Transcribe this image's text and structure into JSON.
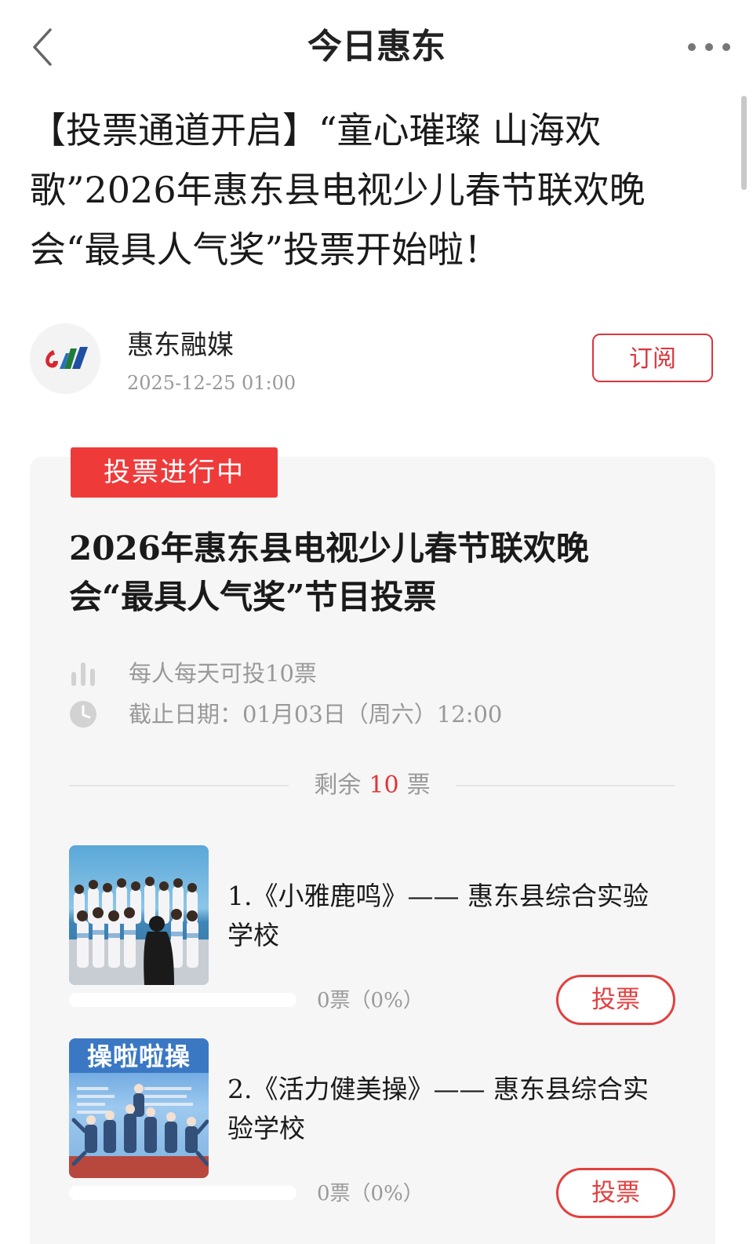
{
  "header": {
    "title": "今日惠东"
  },
  "article": {
    "title": "【投票通道开启】“童心璀璨 山海欢歌”2026年惠东县电视少儿春节联欢晚会“最具人气奖”投票开始啦！"
  },
  "author": {
    "name": "惠东融媒",
    "date": "2025-12-25 01:00",
    "subscribe_label": "订阅"
  },
  "vote": {
    "status_label": "投票进行中",
    "title": "2026年惠东县电视少儿春节联欢晚会“最具人气奖”节目投票",
    "rule": "每人每天可投10票",
    "deadline": "截止日期：01月03日（周六）12:00",
    "remaining_prefix": "剩余",
    "remaining_count": "10",
    "remaining_suffix": "票",
    "accent_color": "#ef3a3a",
    "candidates": [
      {
        "title": "1.《小雅鹿鸣》—— 惠东县综合实验学校",
        "votes_text": "0票（0%）",
        "percent": 0,
        "button_label": "投票"
      },
      {
        "title": "2.《活力健美操》—— 惠东县综合实验学校",
        "votes_text": "0票（0%）",
        "percent": 0,
        "thumb_banner": "操啦啦操",
        "button_label": "投票"
      }
    ]
  }
}
